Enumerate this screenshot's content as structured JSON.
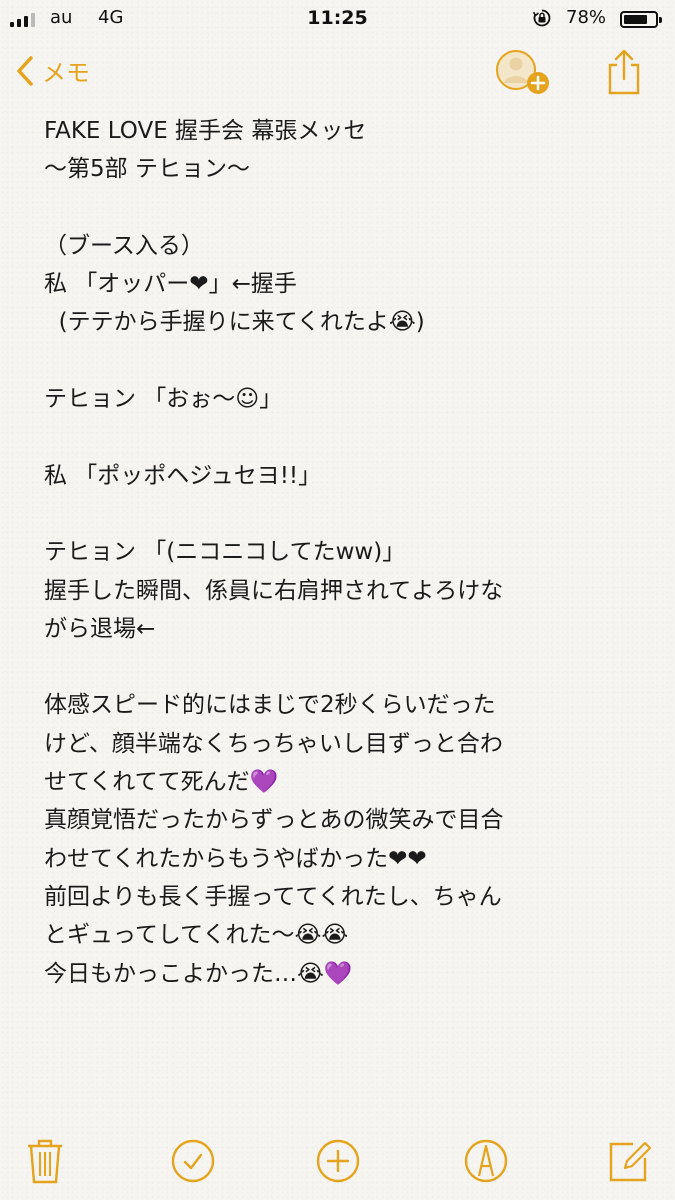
{
  "status": {
    "carrier": "au",
    "network": "4G",
    "time": "11:25",
    "battery": "78%",
    "battery_level": 0.78
  },
  "nav": {
    "back_label": "メモ",
    "icons": [
      "chevron-left-icon",
      "add-person-icon",
      "share-icon"
    ]
  },
  "note": {
    "lines": [
      "FAKE LOVE 握手会 幕張メッセ",
      "〜第5部 テヒョン〜",
      "",
      "（ブース入る）",
      "私 「オッパー❤」←握手",
      "  (テテから手握りに来てくれたよ😭)",
      "",
      "テヒョン 「おぉ〜☺」",
      "",
      "私 「ポッポヘジュセヨ!!」",
      "",
      "テヒョン 「(ニコニコしてたww)」",
      "握手した瞬間、係員に右肩押されてよろけな",
      "がら退場←",
      "",
      "体感スピード的にはまじで2秒くらいだった",
      "けど、顔半端なくちっちゃいし目ずっと合わ",
      "せてくれてて死んだ💜",
      "真顔覚悟だったからずっとあの微笑みで目合",
      "わせてくれたからもうやばかった❤❤",
      "前回よりも長く手握っててくれたし、ちゃん",
      "とギュってしてくれた〜😭😭",
      "今日もかっこよかった…😭💜"
    ]
  },
  "toolbar": {
    "icons": [
      "trash-icon",
      "checklist-icon",
      "add-icon",
      "markup-icon",
      "compose-icon"
    ]
  },
  "colors": {
    "accent": "#e6a41e",
    "background": "#f6f5f1",
    "text": "#1b1b1b"
  }
}
